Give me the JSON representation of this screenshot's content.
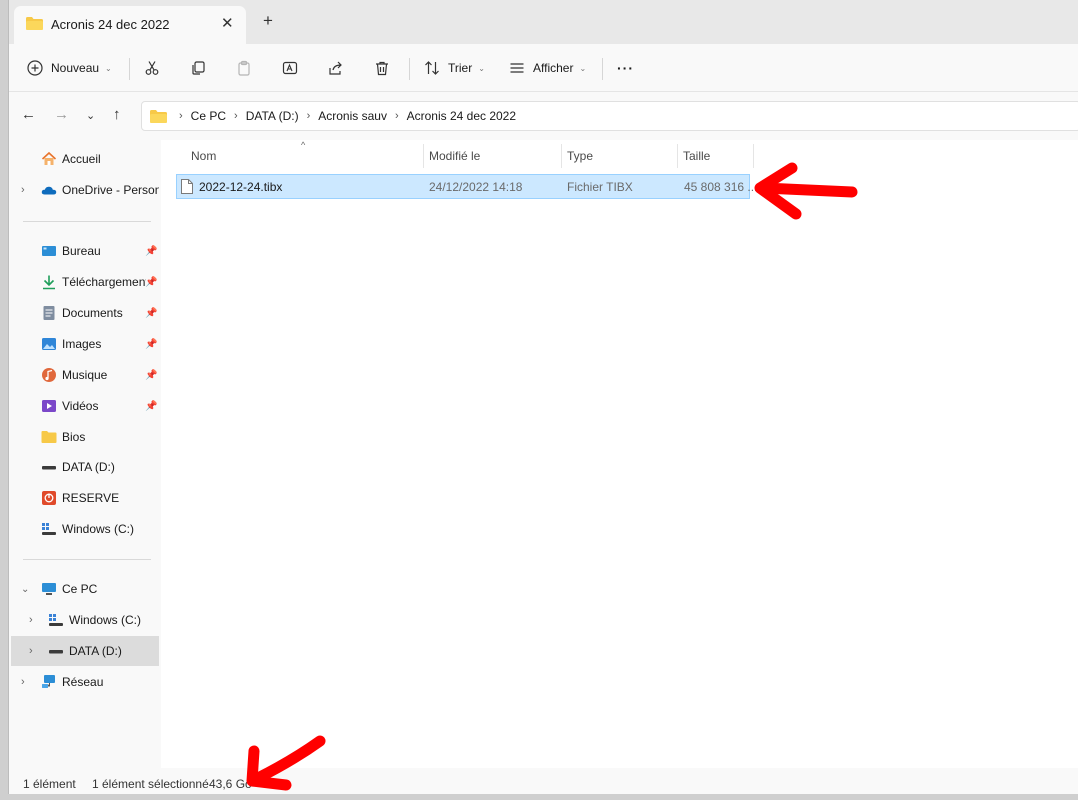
{
  "window": {
    "tab_title": "Acronis 24 dec 2022",
    "tab_close_glyph": "✕",
    "new_tab_glyph": "+"
  },
  "toolbar": {
    "new_label": "Nouveau",
    "sort_label": "Trier",
    "view_label": "Afficher",
    "more_glyph": "···"
  },
  "breadcrumb": [
    "Ce PC",
    "DATA (D:)",
    "Acronis sauv",
    "Acronis 24 dec 2022"
  ],
  "sidebar": {
    "items": [
      {
        "label": "Accueil"
      },
      {
        "label": "OneDrive - Personal"
      },
      {
        "label": "Bureau"
      },
      {
        "label": "Téléchargement"
      },
      {
        "label": "Documents"
      },
      {
        "label": "Images"
      },
      {
        "label": "Musique"
      },
      {
        "label": "Vidéos"
      },
      {
        "label": "Bios"
      },
      {
        "label": "DATA (D:)"
      },
      {
        "label": "RESERVE"
      },
      {
        "label": "Windows (C:)"
      },
      {
        "label": "Ce PC"
      },
      {
        "label": "Windows (C:)"
      },
      {
        "label": "DATA (D:)"
      },
      {
        "label": "Réseau"
      }
    ]
  },
  "columns": [
    "Nom",
    "Modifié le",
    "Type",
    "Taille"
  ],
  "files": [
    {
      "name": "2022-12-24.tibx",
      "modified": "24/12/2022 14:18",
      "type": "Fichier TIBX",
      "size": "45 808 316 ..."
    }
  ],
  "status": {
    "count": "1 élément",
    "selected": "1 élément sélectionné",
    "size": "43,6 Go"
  },
  "colors": {
    "selection_bg": "#cce8ff",
    "selection_border": "#99d1ff",
    "annotation_arrow": "#ff0000",
    "folder": "#f7c948"
  }
}
